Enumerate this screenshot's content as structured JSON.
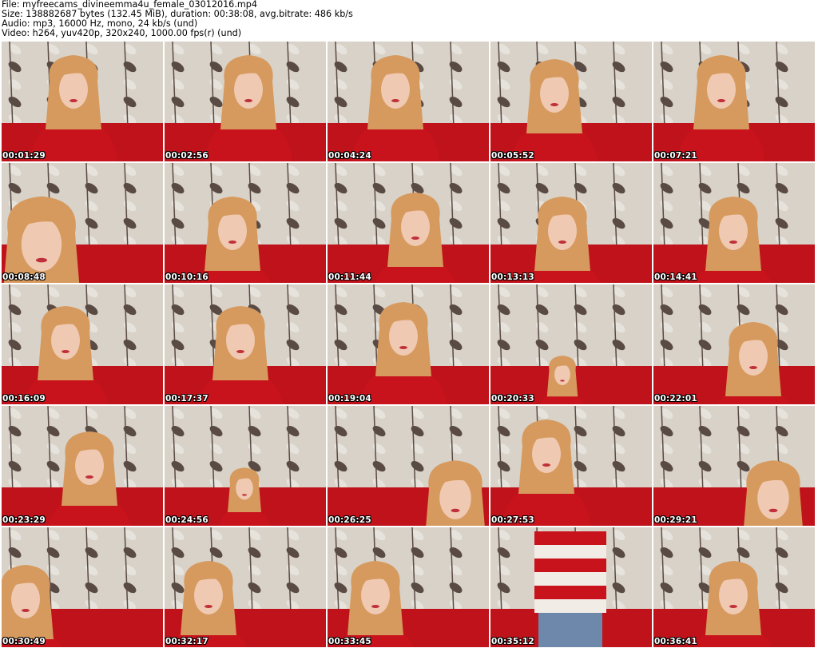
{
  "header": {
    "line1": "File: myfreecams_divineemma4u_female_03012016.mp4",
    "line2": "Size: 138882687 bytes (132.45 MiB), duration: 00:38:08, avg.bitrate: 486 kb/s",
    "line3": "Audio: mp3, 16000 Hz, mono, 24 kb/s (und)",
    "line4": "Video: h264, yuv420p, 320x240, 1000.00 fps(r) (und)"
  },
  "thumbnails": [
    "00:01:29",
    "00:02:56",
    "00:04:24",
    "00:05:52",
    "00:07:21",
    "00:08:48",
    "00:10:16",
    "00:11:44",
    "00:13:13",
    "00:14:41",
    "00:16:09",
    "00:17:37",
    "00:19:04",
    "00:20:33",
    "00:22:01",
    "00:23:29",
    "00:24:56",
    "00:26:25",
    "00:27:53",
    "00:29:21",
    "00:30:49",
    "00:32:17",
    "00:33:45",
    "00:35:12",
    "00:36:41"
  ],
  "colors": {
    "wall": "#d8d2c8",
    "leaf_dark": "#5a4a44",
    "leaf_light": "#e6e2dc",
    "sofa": "#c0121a",
    "hair": "#d79a5e",
    "skin": "#efc9b2",
    "sweater": "#c8131c"
  }
}
